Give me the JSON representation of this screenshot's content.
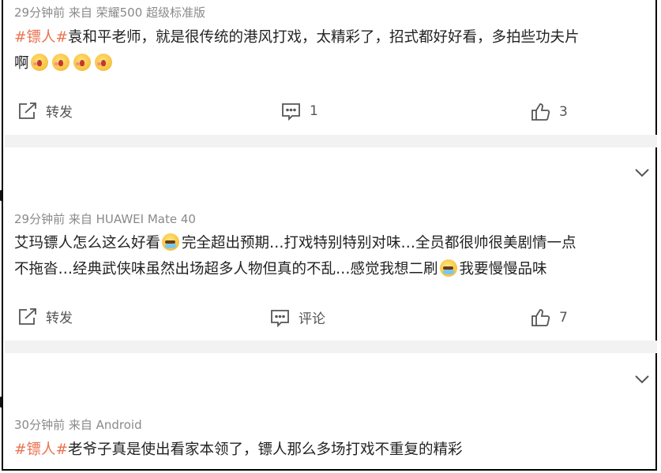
{
  "posts": [
    {
      "meta": "29分钟前  来自 荣耀500 超级标准版",
      "tag": "#镖人#",
      "text": "袁和平老师，就是很传统的港风打戏，太精彩了，招式都好好看，多拍些功夫片",
      "text_line2": "啊",
      "repost_label": "转发",
      "comment_label": "1",
      "like_count": "3"
    },
    {
      "meta": "29分钟前  来自 HUAWEI Mate 40",
      "text_a": "艾玛镖人怎么这么好看",
      "text_b": "完全超出预期…打戏特别特别对味…全员都很帅很美剧情一点",
      "text_c": "不拖沓…经典武侠味虽然出场超多人物但真的不乱…感觉我想二刷",
      "text_d": "我要慢慢品味",
      "repost_label": "转发",
      "comment_label": "评论",
      "like_count": "7"
    },
    {
      "meta": "30分钟前  来自 Android",
      "tag": "#镖人#",
      "text": "老爷子真是使出看家本领了，镖人那么多场打戏不重复的精彩"
    }
  ],
  "icons": {
    "repost": "share-icon",
    "comment": "comment-icon",
    "like": "thumbs-up-icon",
    "collapse": "chevron-down-icon"
  },
  "colors": {
    "tag": "#eb7350",
    "meta": "#8a8a8a",
    "text": "#222222"
  }
}
